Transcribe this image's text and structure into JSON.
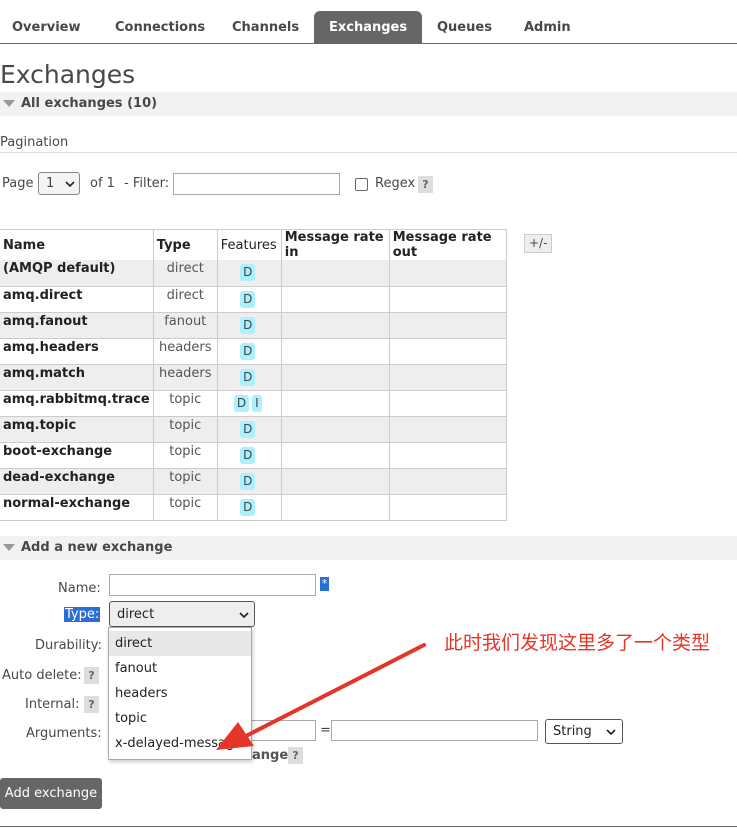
{
  "nav": {
    "tabs": [
      {
        "label": "Overview"
      },
      {
        "label": "Connections"
      },
      {
        "label": "Channels"
      },
      {
        "label": "Exchanges",
        "active": true
      },
      {
        "label": "Queues"
      },
      {
        "label": "Admin"
      }
    ]
  },
  "page_title": "Exchanges",
  "all_exchanges_header": "All exchanges (10)",
  "pagination": {
    "label": "Pagination",
    "page_label": "Page",
    "page_value": "1",
    "of_label": "of 1",
    "filter_label": "- Filter:",
    "filter_value": "",
    "regex_label": "Regex",
    "help": "?"
  },
  "table": {
    "headers": [
      "Name",
      "Type",
      "Features",
      "Message rate in",
      "Message rate out"
    ],
    "toggle_columns": "+/-",
    "rows": [
      {
        "name": "(AMQP default)",
        "type": "direct",
        "features": [
          "D"
        ]
      },
      {
        "name": "amq.direct",
        "type": "direct",
        "features": [
          "D"
        ]
      },
      {
        "name": "amq.fanout",
        "type": "fanout",
        "features": [
          "D"
        ]
      },
      {
        "name": "amq.headers",
        "type": "headers",
        "features": [
          "D"
        ]
      },
      {
        "name": "amq.match",
        "type": "headers",
        "features": [
          "D"
        ]
      },
      {
        "name": "amq.rabbitmq.trace",
        "type": "topic",
        "features": [
          "D",
          "I"
        ]
      },
      {
        "name": "amq.topic",
        "type": "topic",
        "features": [
          "D"
        ]
      },
      {
        "name": "boot-exchange",
        "type": "topic",
        "features": [
          "D"
        ]
      },
      {
        "name": "dead-exchange",
        "type": "topic",
        "features": [
          "D"
        ]
      },
      {
        "name": "normal-exchange",
        "type": "topic",
        "features": [
          "D"
        ]
      }
    ]
  },
  "add_exchange": {
    "header": "Add a new exchange",
    "name_label": "Name:",
    "name_value": "",
    "required_mark": "*",
    "type_label": "Type:",
    "type_value": "direct",
    "type_options": [
      "direct",
      "fanout",
      "headers",
      "topic",
      "x-delayed-message"
    ],
    "durability_label": "Durability:",
    "auto_delete_label": "Auto delete:",
    "internal_label": "Internal:",
    "arguments_label": "Arguments:",
    "equals": "=",
    "arg_type_value": "String",
    "add_link_tail": "ange",
    "help": "?",
    "submit_label": "Add exchange"
  },
  "annotation": {
    "text": "此时我们发现这里多了一个类型",
    "color": "#e53529"
  },
  "colors": {
    "active_tab": "#666666",
    "feature_badge": "#aaf0ff",
    "button": "#666666"
  }
}
